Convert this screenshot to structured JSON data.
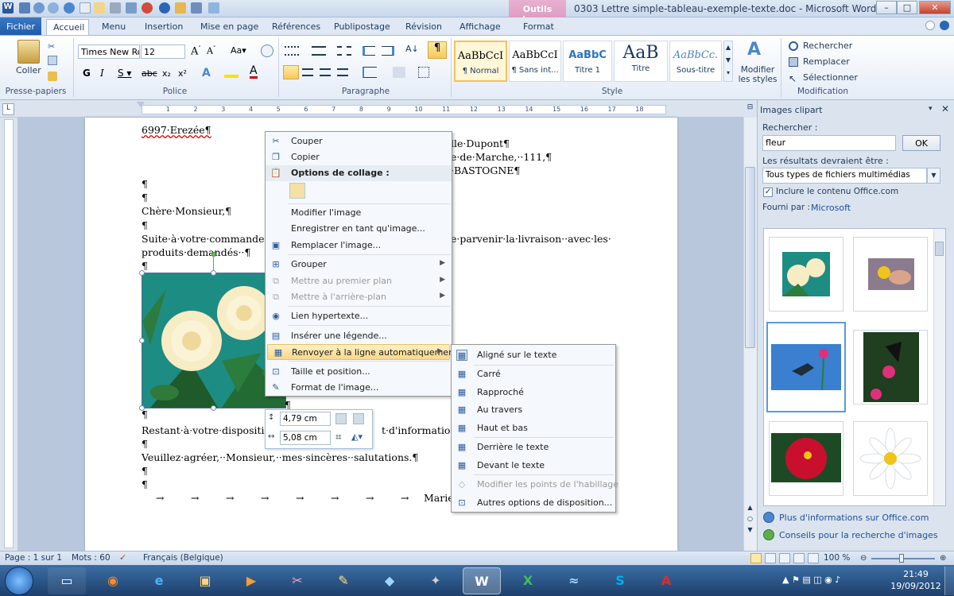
{
  "window": {
    "title": "0303 Lettre simple-tableau-exemple-texte.doc  -  Microsoft Word",
    "context_tab_group": "Outils Image",
    "min": "–",
    "max": "□",
    "close": "✕"
  },
  "tabs": [
    "Fichier",
    "Accueil",
    "Menu",
    "Insertion",
    "Mise en page",
    "Références",
    "Publipostage",
    "Révision",
    "Affichage",
    "Format"
  ],
  "ribbon": {
    "clipboard": {
      "paste": "Coller",
      "group": "Presse-papiers"
    },
    "font": {
      "name": "Times New Ro",
      "size": "12",
      "group": "Police"
    },
    "paragraph": {
      "group": "Paragraphe"
    },
    "styles": {
      "items": [
        {
          "preview": "AaBbCcI",
          "name": "¶ Normal"
        },
        {
          "preview": "AaBbCcI",
          "name": "¶ Sans int..."
        },
        {
          "preview": "AaBbC",
          "name": "Titre 1"
        },
        {
          "preview": "AaB",
          "name": "Titre"
        },
        {
          "preview": "AaBbCc.",
          "name": "Sous-titre"
        }
      ],
      "modify": "Modifier les styles",
      "group": "Style"
    },
    "editing": {
      "find": "Rechercher",
      "replace": "Remplacer",
      "select": "Sélectionner",
      "group": "Modification"
    }
  },
  "ruler_marks": [
    "1",
    "2",
    "3",
    "4",
    "5",
    "6",
    "7",
    "8",
    "9",
    "10",
    "11",
    "12",
    "13",
    "14",
    "15",
    "16",
    "17",
    "18"
  ],
  "document": {
    "line1": "6997·Erezée¶",
    "addr1": "lle·Dupont¶",
    "addr2": "e·de·Marche,··111,¶",
    "addr3": "·BASTOGNE¶",
    "p1": "¶",
    "p2": "¶",
    "greeting": "Chère·Monsieur,¶",
    "p3": "¶",
    "body1a": "Suite·à·votre·commande·d",
    "body1b": "e·parvenir·la·livraison··avec·les·",
    "body2": "produits·demandés··¶",
    "p4": "¶",
    "p5": "¶",
    "closing1a": "Restant·à·votre·disposition",
    "closing1b": "t·d'information,¶",
    "p6": "¶",
    "closing2": "Veuillez·agréer,··Monsieur,··mes·sincères··salutations.¶",
    "p7": "¶",
    "p8": "¶",
    "sign": "Marie",
    "tabs": "→"
  },
  "context_menu": {
    "items": [
      "Couper",
      "Copier",
      "Options de collage :",
      "Modifier l'image",
      "Enregistrer en tant qu'image...",
      "Remplacer l'image...",
      "Grouper",
      "Mettre au premier plan",
      "Mettre à l'arrière-plan",
      "Lien hypertexte...",
      "Insérer une légende...",
      "Renvoyer à la ligne automatiquement",
      "Taille et position...",
      "Format de l'image..."
    ]
  },
  "submenu": {
    "items": [
      "Aligné sur le texte",
      "Carré",
      "Rapproché",
      "Au travers",
      "Haut et bas",
      "Derrière le texte",
      "Devant le texte",
      "Modifier les points de l'habillage",
      "Autres options de disposition..."
    ]
  },
  "mini_toolbar": {
    "height": "4,79 cm",
    "width": "5,08 cm"
  },
  "task_pane": {
    "title": "Images clipart",
    "search_label": "Rechercher :",
    "search_value": "fleur",
    "ok": "OK",
    "results_label": "Les résultats devraient être :",
    "results_value": "Tous types de fichiers multimédias",
    "include_office": "Inclure le contenu Office.com",
    "provider_label": "Fourni par :",
    "provider": "Microsoft",
    "link1": "Plus d'informations sur Office.com",
    "link2": "Conseils pour la recherche d'images"
  },
  "status": {
    "page": "Page : 1 sur 1",
    "words": "Mots : 60",
    "lang": "Français (Belgique)",
    "zoom": "100 %"
  },
  "taskbar": {
    "time": "21:49",
    "date": "19/09/2012"
  }
}
